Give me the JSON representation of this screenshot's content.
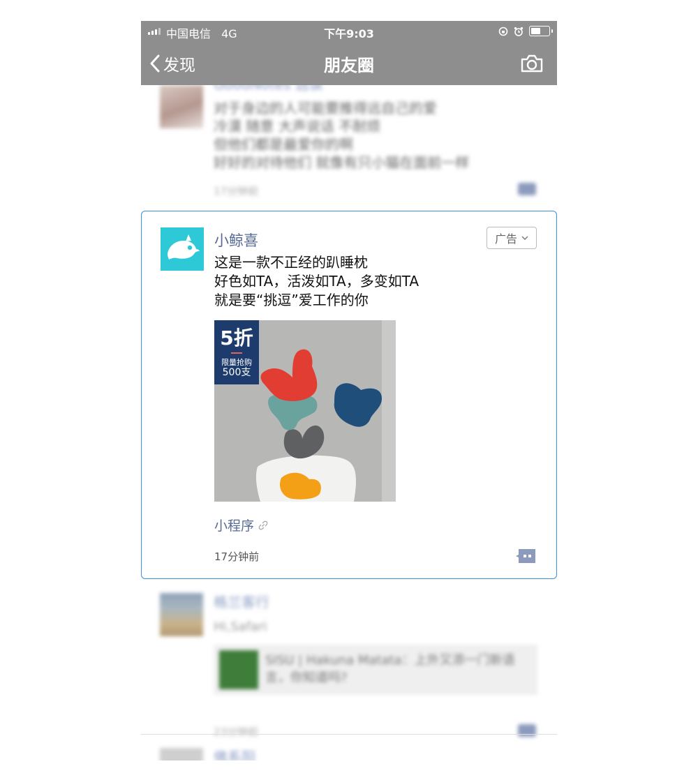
{
  "status": {
    "carrier": "中国电信",
    "network": "4G",
    "time": "下午9:03"
  },
  "nav": {
    "back_label": "发现",
    "title": "朋友圈"
  },
  "feed_top": {
    "name": "GoodNotes 选读",
    "lines": [
      "对于身边的人可能要推得远自己的爱",
      "冷漠 随意 大声说话 不耐烦",
      "但他们都是最爱你的啊",
      "好好的对待他们 就像有只小猫在面前一样"
    ],
    "time": "17分钟前"
  },
  "ad": {
    "name": "小鲸喜",
    "tag": "广告",
    "lines": [
      "这是一款不正经的趴睡枕",
      "好色如TA，活泼如TA，多变如TA",
      "就是要“挑逗”爱工作的你"
    ],
    "discount": {
      "big": "5折",
      "small": "限量抢购",
      "count": "500支"
    },
    "mini_program": "小程序",
    "time": "17分钟前"
  },
  "feed_bottom": {
    "name": "格兰客行",
    "text": "Hi,Safari",
    "link_text": "SISU | Hakuna Matata：上外又添一门新语言，你知道吗?",
    "time": "23分钟前",
    "next_name": "佛系阳"
  },
  "colors": {
    "nav_bg": "#8e8e8e",
    "name_blue": "#576b95",
    "ad_border": "#3a8fe0",
    "brand_teal": "#2dc9d6"
  }
}
